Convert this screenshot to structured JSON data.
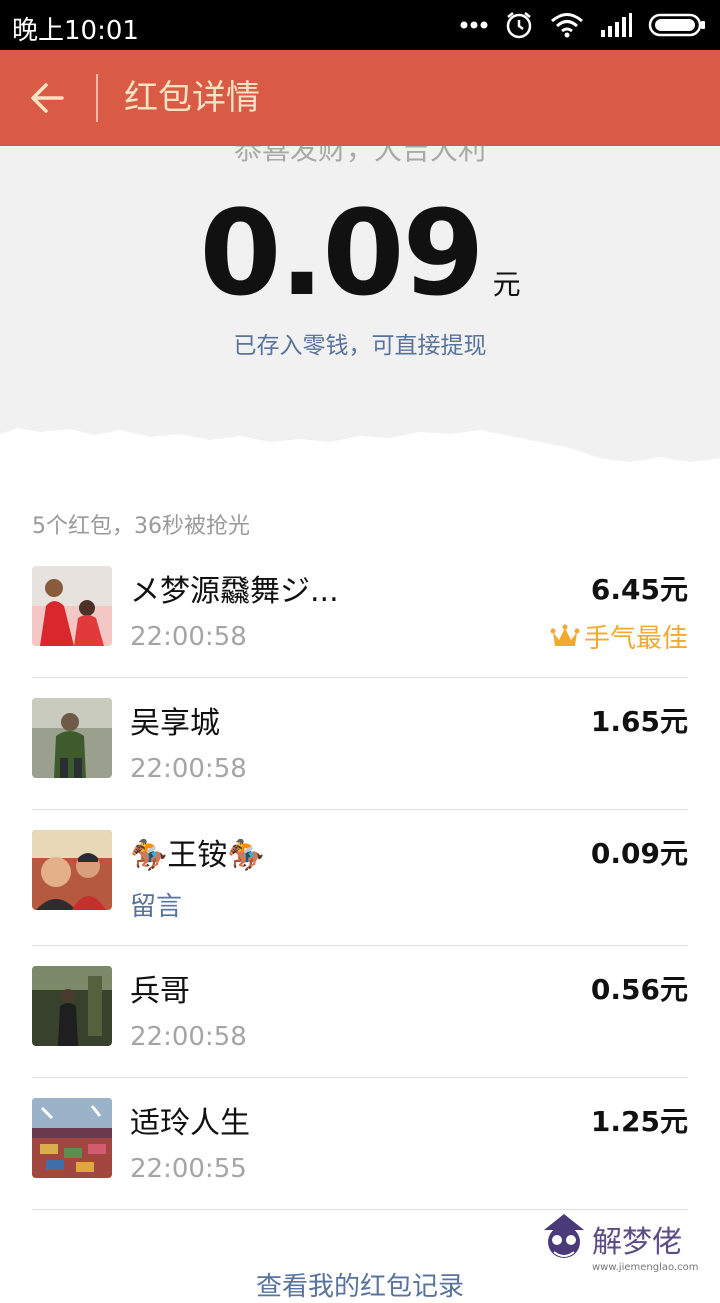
{
  "status": {
    "time": "晚上10:01"
  },
  "header": {
    "title": "红包详情"
  },
  "summary": {
    "greeting": "恭喜发财，大吉大利",
    "amount": "0.09",
    "unit": "元",
    "note": "已存入零钱，可直接提现"
  },
  "list": {
    "summary": "5个红包，36秒被抢光",
    "rows": [
      {
        "name": "メ梦源飝舞ジ...",
        "time": "22:00:58",
        "amount": "6.45元",
        "best": "手气最佳"
      },
      {
        "name": "吴享城",
        "time": "22:00:58",
        "amount": "1.65元"
      },
      {
        "name": "🏇王铵🏇",
        "message": "留言",
        "amount": "0.09元"
      },
      {
        "name": "兵哥",
        "time": "22:00:58",
        "amount": "0.56元"
      },
      {
        "name": "适玲人生",
        "time": "22:00:55",
        "amount": "1.25元"
      }
    ]
  },
  "bottom_link": "查看我的红包记录",
  "watermark": {
    "brand": "解梦佬",
    "site": "www.jiemenglao.com"
  },
  "colors": {
    "header_bg": "#d95b45",
    "title": "#f7e2c3",
    "link": "#58739c",
    "best": "#f2a92c"
  },
  "icons": [
    "back-arrow-icon",
    "alarm-icon",
    "wifi-icon",
    "signal-icon",
    "battery-icon",
    "crown-icon"
  ]
}
